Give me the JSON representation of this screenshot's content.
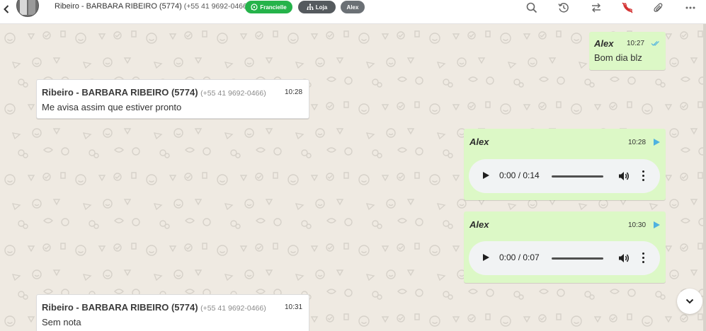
{
  "header": {
    "contact_name": "Ribeiro - BARBARA RIBEIRO (5774)",
    "contact_phone": "(+55 41 9692-0466)",
    "tags": [
      {
        "label": "Francielle",
        "color": "#25b34a",
        "icon": "whatsapp-icon"
      },
      {
        "label": "Loja",
        "color": "#555a5e",
        "icon": "sitemap-icon"
      },
      {
        "label": "Alex",
        "color": "#6b7075"
      }
    ],
    "icons": [
      "search-icon",
      "history-icon",
      "transfer-icon",
      "end-call-icon",
      "attach-icon",
      "more-icon"
    ]
  },
  "messages": [
    {
      "direction": "out",
      "sender": "Alex",
      "time": "10:27",
      "text": "Bom dia blz",
      "status_icon": "double-check-icon"
    },
    {
      "direction": "in",
      "sender": "Ribeiro - BARBARA RIBEIRO (5774)",
      "phone": "(+55 41 9692-0466)",
      "time": "10:28",
      "text": "Me avisa assim que estiver pronto"
    },
    {
      "direction": "out",
      "sender": "Alex",
      "time": "10:28",
      "type": "audio",
      "audio_time": "0:00 / 0:14"
    },
    {
      "direction": "out",
      "sender": "Alex",
      "time": "10:30",
      "type": "audio",
      "audio_time": "0:00 / 0:07"
    },
    {
      "direction": "in",
      "sender": "Ribeiro - BARBARA RIBEIRO (5774)",
      "phone": "(+55 41 9692-0466)",
      "time": "10:31",
      "text": "Sem nota"
    }
  ],
  "colors": {
    "chat_background": "#efeae2",
    "outgoing_bubble": "#dcf8c6",
    "incoming_bubble": "#ffffff",
    "read_check": "#4fb2e0"
  }
}
